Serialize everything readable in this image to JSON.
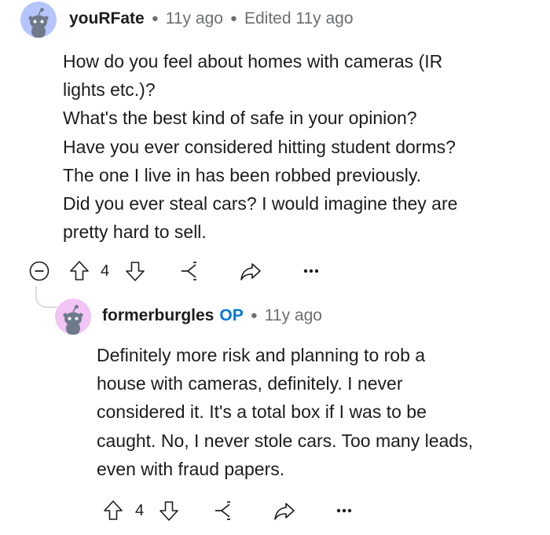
{
  "comments": [
    {
      "username": "youRFate",
      "op_badge": "",
      "time": "11y ago",
      "edited": "Edited 11y ago",
      "body": "How do you feel about homes with cameras (IR\nlights etc.)?\nWhat's the best kind of safe in your opinion?\nHave you ever considered hitting student dorms?\nThe one I live in has been robbed previously.\nDid you ever steal cars? I would imagine they are\npretty hard to sell.",
      "votes": "4",
      "avatar_color": "#b6c4ff",
      "icons": [
        "collapse-icon",
        "upvote-icon",
        "downvote-icon",
        "award-icon",
        "share-icon",
        "more-icon"
      ]
    },
    {
      "username": "formerburgles",
      "op_badge": "OP",
      "time": "11y ago",
      "body": "Definitely more risk and planning to rob a\nhouse with cameras, definitely. I never\nconsidered it. It's a total box if I was to be\ncaught. No, I never stole cars. Too many leads,\neven with fraud papers.",
      "votes": "4",
      "avatar_color": "#f1c4f5",
      "icons": [
        "upvote-icon",
        "downvote-icon",
        "award-icon",
        "share-icon",
        "more-icon"
      ]
    }
  ],
  "colors": {
    "text": "#1c1c1c",
    "meta": "#6b6f72",
    "op": "#0079d3",
    "thread": "#dadcdf"
  }
}
